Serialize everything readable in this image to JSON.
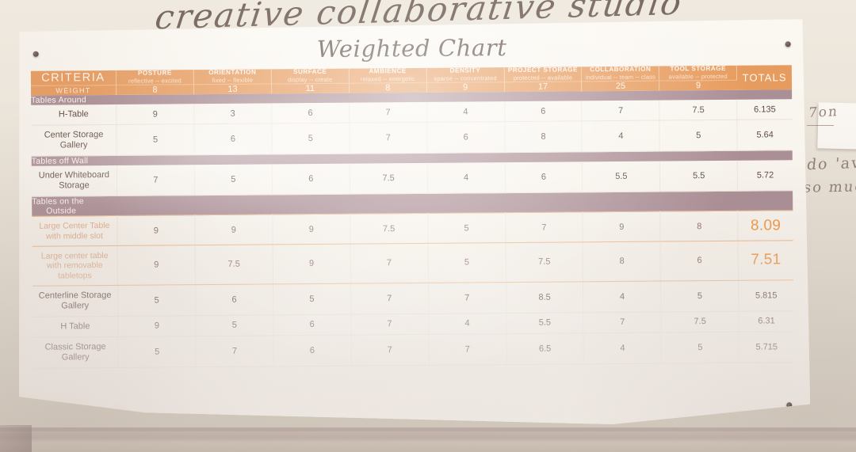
{
  "environment": {
    "handwriting_top": "creative collaborative studio",
    "note_line1": "7on",
    "note_line2": "do 'av",
    "note_line3": "so much"
  },
  "poster": {
    "title": "Weighted Chart"
  },
  "chart_data": {
    "type": "table",
    "title": "Weighted Chart",
    "criteria_header": "CRITERIA",
    "weight_label": "WEIGHT",
    "totals_header": "TOTALS",
    "columns": [
      {
        "name": "POSTURE",
        "scale": "reflective -- excited",
        "weight": "8"
      },
      {
        "name": "ORIENTATION",
        "scale": "fixed -- flexible",
        "weight": "13"
      },
      {
        "name": "SURFACE",
        "scale": "display -- create",
        "weight": "11"
      },
      {
        "name": "AMBIENCE",
        "scale": "relaxed -- energetic",
        "weight": "8"
      },
      {
        "name": "DENSITY",
        "scale": "sparse -- concentrated",
        "weight": "9"
      },
      {
        "name": "PROJECT STORAGE",
        "scale": "protected -- available",
        "weight": "17"
      },
      {
        "name": "COLLABORATION",
        "scale": "individual -- team -- class",
        "weight": "25"
      },
      {
        "name": "TOOL STORAGE",
        "scale": "available -- protected",
        "weight": "9"
      }
    ],
    "sections": [
      {
        "label": "Tables Around",
        "rows": [
          {
            "label": "H-Table",
            "values": [
              "9",
              "3",
              "6",
              "7",
              "4",
              "6",
              "7",
              "7.5"
            ],
            "total": "6.135",
            "highlight": false
          },
          {
            "label": "Center Storage Gallery",
            "values": [
              "5",
              "6",
              "5",
              "7",
              "6",
              "8",
              "4",
              "5"
            ],
            "total": "5.64",
            "highlight": false
          }
        ]
      },
      {
        "label": "Tables off Wall",
        "rows": [
          {
            "label": "Under Whiteboard Storage",
            "values": [
              "7",
              "5",
              "6",
              "7.5",
              "4",
              "6",
              "5.5",
              "5.5"
            ],
            "total": "5.72",
            "highlight": false
          }
        ]
      },
      {
        "label": "Tables on the Outside",
        "rows": [
          {
            "label": "Large Center Table with middle slot",
            "values": [
              "9",
              "9",
              "9",
              "7.5",
              "5",
              "7",
              "9",
              "8"
            ],
            "total": "8.09",
            "highlight": true
          },
          {
            "label": "Large center table with removable tabletops",
            "values": [
              "9",
              "7.5",
              "9",
              "7",
              "5",
              "7.5",
              "8",
              "6"
            ],
            "total": "7.51",
            "highlight": true
          },
          {
            "label": "Centerline Storage Gallery",
            "values": [
              "5",
              "6",
              "5",
              "7",
              "7",
              "8.5",
              "4",
              "5"
            ],
            "total": "5.815",
            "highlight": false
          },
          {
            "label": "H Table",
            "values": [
              "9",
              "5",
              "6",
              "7",
              "4",
              "5.5",
              "7",
              "7.5"
            ],
            "total": "6.31",
            "highlight": false
          },
          {
            "label": "Classic Storage Gallery",
            "values": [
              "5",
              "7",
              "6",
              "7",
              "7",
              "6.5",
              "4",
              "5"
            ],
            "total": "5.715",
            "highlight": false
          }
        ]
      }
    ],
    "colors": {
      "header_orange": "#e79c5f",
      "section_band": "#ab8f96",
      "highlight_total": "#ef9a4e",
      "paper": "#faf7f1"
    }
  }
}
